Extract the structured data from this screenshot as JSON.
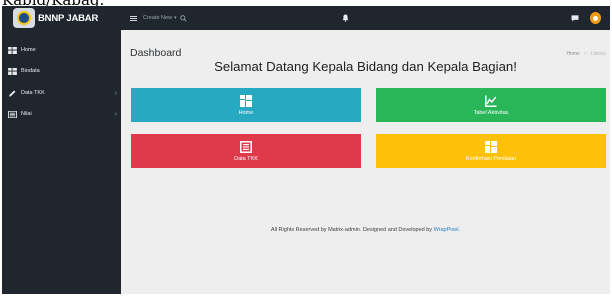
{
  "caption": "Kabid/Kabag.",
  "topbar": {
    "brand": "BNNP JABAR",
    "create_new": "Create New",
    "menu_icon": "hamburger-icon",
    "search_icon": "search-icon",
    "bell_icon": "bell-icon",
    "chat_icon": "chat-icon"
  },
  "sidebar": {
    "items": [
      {
        "label": "Home",
        "icon": "dashboard-icon"
      },
      {
        "label": "Biodata",
        "icon": "dashboard-icon"
      },
      {
        "label": "Data TKK",
        "icon": "pencil-icon"
      },
      {
        "label": "Nilai",
        "icon": "list-icon"
      }
    ]
  },
  "main": {
    "title": "Dashboard",
    "breadcrumb": {
      "home": "Home",
      "current": "Library"
    },
    "welcome": "Selamat Datang Kepala Bidang dan Kepala Bagian!",
    "tiles": [
      {
        "label": "Home",
        "color": "#27a9c1",
        "icon": "dashboard-icon"
      },
      {
        "label": "Tabel Aktivitas",
        "color": "#28b659",
        "icon": "chart-icon"
      },
      {
        "label": "Data TKK",
        "color": "#e0394a",
        "icon": "list-icon"
      },
      {
        "label": "Konfirmasi Penilaian",
        "color": "#ffc107",
        "icon": "dashboard-icon"
      }
    ],
    "footer": {
      "text": "All Rights Reserved by Matrix-admin. Designed and Developed by",
      "brand": "WrapPixel."
    }
  }
}
